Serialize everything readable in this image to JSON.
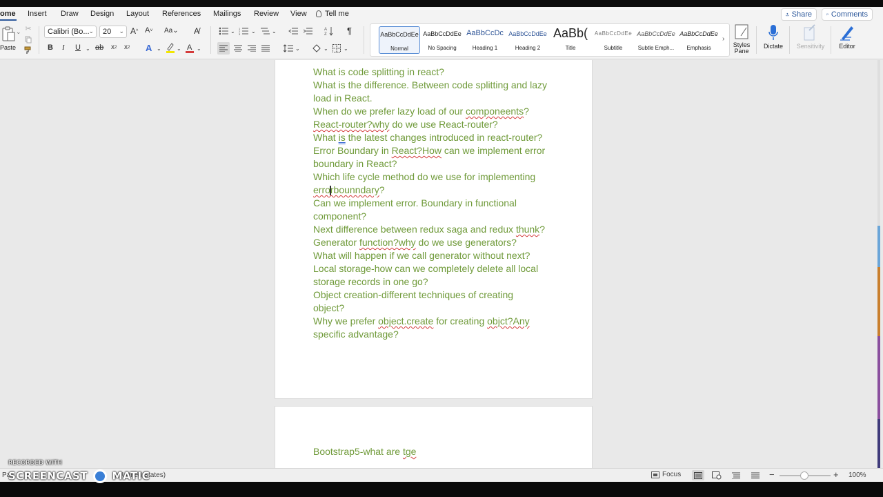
{
  "tabs": [
    "ome",
    "Insert",
    "Draw",
    "Design",
    "Layout",
    "References",
    "Mailings",
    "Review",
    "View",
    "Tell me"
  ],
  "share_label": "Share",
  "comments_label": "Comments",
  "clipboard": {
    "paste_label": "Paste"
  },
  "font": {
    "name": "Calibri (Bo...",
    "size": "20"
  },
  "styles": [
    {
      "sample": "AaBbCcDdEe",
      "name": "Normal"
    },
    {
      "sample": "AaBbCcDdEe",
      "name": "No Spacing"
    },
    {
      "sample": "AaBbCcDc",
      "name": "Heading 1"
    },
    {
      "sample": "AaBbCcDdEe",
      "name": "Heading 2"
    },
    {
      "sample": "AaBb(",
      "name": "Title"
    },
    {
      "sample": "AaBbCcDdEe",
      "name": "Subtitle"
    },
    {
      "sample": "AaBbCcDdEe",
      "name": "Subtle Emph..."
    },
    {
      "sample": "AaBbCcDdEe",
      "name": "Emphasis"
    }
  ],
  "styles_pane_label": [
    "Styles",
    "Pane"
  ],
  "dictate_label": "Dictate",
  "sensitivity_label": "Sensitivity",
  "editor_label": "Editor",
  "document": {
    "page1_lines": [
      [
        {
          "t": "What is code splitting in react?"
        }
      ],
      [
        {
          "t": "What is the difference. Between code splitting and lazy"
        }
      ],
      [
        {
          "t": "load in React."
        }
      ],
      [
        {
          "t": "When do we prefer lazy load of our "
        },
        {
          "t": "componeents",
          "sq": "red"
        },
        {
          "t": "?"
        }
      ],
      [
        {
          "t": "React-router?why",
          "sq": "red"
        },
        {
          "t": " do we use React-router?"
        }
      ],
      [
        {
          "t": "What "
        },
        {
          "t": "is",
          "sq": "blue"
        },
        {
          "t": " the latest changes introduced in react-router?"
        }
      ],
      [
        {
          "t": "Error Boundary in "
        },
        {
          "t": "React?How",
          "sq": "red"
        },
        {
          "t": " can we implement error"
        }
      ],
      [
        {
          "t": "boundary in React?"
        }
      ],
      [
        {
          "t": "Which life cycle method do we use for implementing"
        }
      ],
      [
        {
          "t": "errorbounndary",
          "sq": "red"
        },
        {
          "t": "?"
        }
      ],
      [
        {
          "t": "Can we implement error. Boundary in functional"
        }
      ],
      [
        {
          "t": "component?"
        }
      ],
      [
        {
          "t": "Next difference between redux saga and redux "
        },
        {
          "t": "thunk",
          "sq": "red"
        },
        {
          "t": "?"
        }
      ],
      [
        {
          "t": "Generator "
        },
        {
          "t": "function?why",
          "sq": "red"
        },
        {
          "t": " do we use generators?"
        }
      ],
      [
        {
          "t": "What will happen if we call generator without next?"
        }
      ],
      [
        {
          "t": "Local storage-how can we completely delete all local"
        }
      ],
      [
        {
          "t": "storage records in one go?"
        }
      ],
      [
        {
          "t": "Object creation-different techniques of creating"
        }
      ],
      [
        {
          "t": "object?"
        }
      ],
      [
        {
          "t": "Why we prefer "
        },
        {
          "t": "object.create",
          "sq": "red"
        },
        {
          "t": " for creating "
        },
        {
          "t": "objct?Any",
          "sq": "red"
        }
      ],
      [
        {
          "t": "specific advantage?"
        }
      ]
    ],
    "page2_lines": [
      [
        {
          "t": "Bootstrap5-what are "
        },
        {
          "t": "tge",
          "sq": "red"
        }
      ]
    ]
  },
  "status": {
    "page_text": "Pa",
    "language": "h (United States)",
    "focus_label": "Focus",
    "zoom": "100%"
  },
  "watermark": {
    "line1": "RECORDED WITH",
    "line2": "SCREENCAST",
    "line3": "MATIC"
  },
  "colors": {
    "text_green": "#6f9a39",
    "accent": "#2b579a"
  }
}
